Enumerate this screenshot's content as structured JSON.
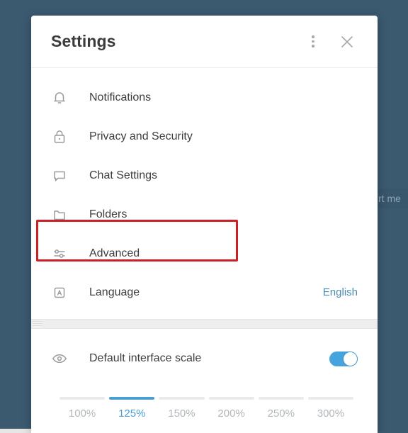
{
  "background": {
    "color": "#3b5a70",
    "partial_banner_text": "rt me"
  },
  "header": {
    "title": "Settings",
    "menu_icon": "kebab-menu-icon",
    "close_icon": "close-icon"
  },
  "menu": {
    "items": [
      {
        "label": "Notifications",
        "icon": "bell-icon",
        "value": ""
      },
      {
        "label": "Privacy and Security",
        "icon": "lock-icon",
        "value": ""
      },
      {
        "label": "Chat Settings",
        "icon": "chat-icon",
        "value": ""
      },
      {
        "label": "Folders",
        "icon": "folder-icon",
        "value": ""
      },
      {
        "label": "Advanced",
        "icon": "sliders-icon",
        "value": ""
      },
      {
        "label": "Language",
        "icon": "letter-a-icon",
        "value": "English"
      }
    ],
    "highlight": {
      "target_label": "Advanced",
      "color": "#cc2026"
    }
  },
  "scale_section": {
    "icon": "eye-icon",
    "label": "Default interface scale",
    "toggle_on": true,
    "toggle_color": "#46a4dd",
    "selected": "125%",
    "options": [
      "100%",
      "125%",
      "150%",
      "200%",
      "250%",
      "300%"
    ]
  },
  "colors": {
    "accent": "#4a9fd0",
    "link": "#4a8cb0",
    "text": "#3d3d3d",
    "icon": "#9b9b9b",
    "muted": "#b2b6b9"
  }
}
